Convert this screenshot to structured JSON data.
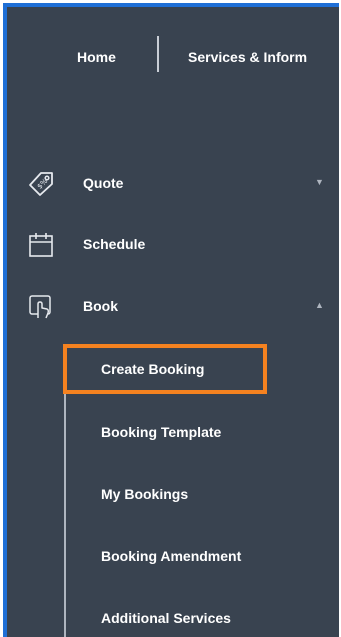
{
  "topnav": {
    "home_label": "Home",
    "services_label": "Services & Inform"
  },
  "menu": {
    "quote": {
      "label": "Quote",
      "icon": "tag-icon",
      "chevron": "▼"
    },
    "schedule": {
      "label": "Schedule",
      "icon": "calendar-icon"
    },
    "book": {
      "label": "Book",
      "icon": "hand-pointer-icon",
      "chevron": "▲"
    }
  },
  "book_submenu": [
    {
      "label": "Create Booking",
      "highlighted": true
    },
    {
      "label": "Booking Template"
    },
    {
      "label": "My Bookings"
    },
    {
      "label": "Booking Amendment"
    },
    {
      "label": "Additional Services"
    }
  ],
  "colors": {
    "sidebar_bg": "#394350",
    "frame_border": "#1f6fd6",
    "highlight": "#f58220",
    "text": "#ffffff"
  }
}
